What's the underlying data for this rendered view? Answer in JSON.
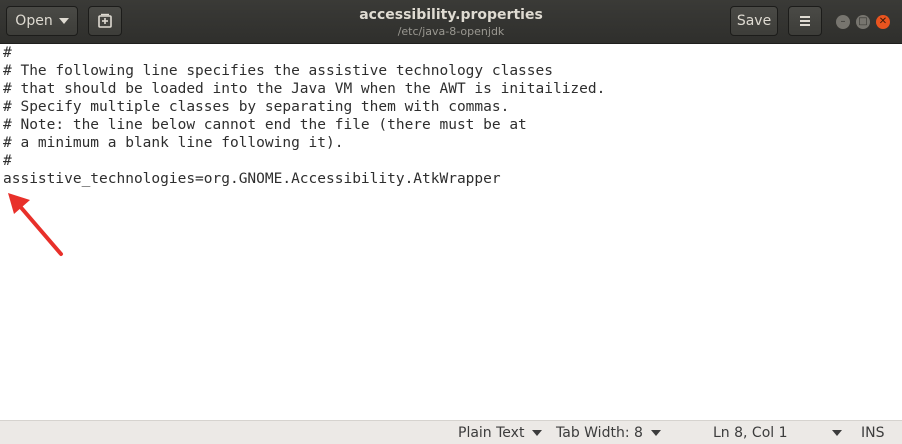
{
  "header": {
    "open_label": "Open",
    "title": "accessibility.properties",
    "subtitle": "/etc/java-8-openjdk",
    "save_label": "Save"
  },
  "editor": {
    "lines": [
      "#",
      "# The following line specifies the assistive technology classes",
      "# that should be loaded into the Java VM when the AWT is initailized.",
      "# Specify multiple classes by separating them with commas.",
      "# Note: the line below cannot end the file (there must be at",
      "# a minimum a blank line following it).",
      "#",
      "assistive_technologies=org.GNOME.Accessibility.AtkWrapper"
    ]
  },
  "statusbar": {
    "language": "Plain Text",
    "tab_width": "Tab Width: 8",
    "position": "Ln 8, Col 1",
    "mode": "INS"
  },
  "icons": {
    "new_document": "new-document-icon",
    "menu": "hamburger-menu-icon",
    "minimize": "minimize-icon",
    "maximize": "maximize-icon",
    "close": "close-icon"
  },
  "colors": {
    "header_bg": "#33332f",
    "close_button": "#e9541f",
    "annotation_arrow": "#e8302a"
  }
}
